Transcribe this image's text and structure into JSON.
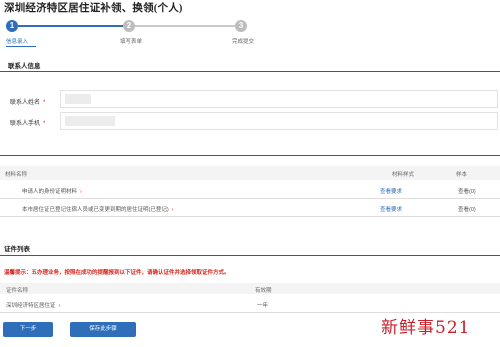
{
  "page": {
    "title": "深圳经济特区居住证补领、换领(个人)"
  },
  "steps": [
    {
      "number": "1",
      "label": "信息录入",
      "state": "active"
    },
    {
      "number": "2",
      "label": "填写表单",
      "state": "idle"
    },
    {
      "number": "3",
      "label": "完成提交",
      "state": "idle"
    }
  ],
  "contact": {
    "section_title": "联系人信息",
    "name_label": "联系人姓名",
    "phone_label": "联系人手机",
    "required_mark": "*"
  },
  "materials": {
    "headers": {
      "name": "材料名称",
      "example": "材料样式",
      "sample": "样本"
    },
    "rows": [
      {
        "name": "申请人的身份证明材料",
        "arrow": "›",
        "example": "查看要求",
        "sample": "查看(0)"
      },
      {
        "name": "本市居住证已登记住宿人员或已变更到期的居住证明(已登记)",
        "arrow": "›",
        "example": "查看要求",
        "sample": "查看(0)"
      }
    ]
  },
  "certificates": {
    "section_title": "证件列表",
    "notice": "温馨提示：五办理业务，按照在成功的提醒报到以下证件，请确认证件并选择领取证件方式。",
    "headers": {
      "name": "证件名称",
      "validity": "有效期"
    },
    "rows": [
      {
        "name": "深圳经济特区居住证",
        "arrow": "›",
        "validity": "一年"
      }
    ]
  },
  "buttons": {
    "next": "下一步",
    "save": "保存此步骤"
  },
  "watermark": "新鲜事521",
  "colors": {
    "primary": "#2f6fb9",
    "required": "#d9251d",
    "watermark": "#c8202a"
  }
}
